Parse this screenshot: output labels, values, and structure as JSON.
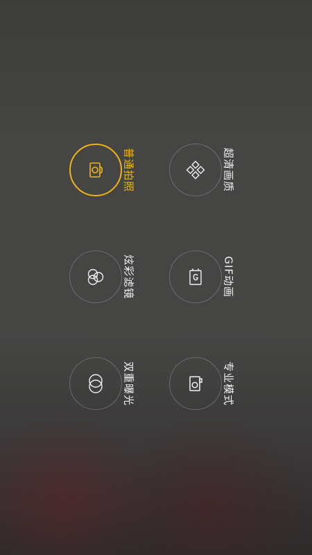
{
  "modes": [
    {
      "key": "normal",
      "label": "普通拍照",
      "icon": "camera-icon",
      "active": true
    },
    {
      "key": "uhd",
      "label": "超清画质",
      "icon": "diamond-grid-icon",
      "active": false
    },
    {
      "key": "filter",
      "label": "炫彩滤镜",
      "icon": "color-filter-icon",
      "active": false
    },
    {
      "key": "gif",
      "label": "GIF动画",
      "icon": "gif-icon",
      "active": false
    },
    {
      "key": "double",
      "label": "双重曝光",
      "icon": "double-exposure-icon",
      "active": false
    },
    {
      "key": "pro",
      "label": "专业模式",
      "icon": "pro-camera-icon",
      "active": false
    }
  ],
  "colors": {
    "accent": "#f0b416",
    "ring": "rgba(255,255,255,0.22)",
    "text": "#f2f2f2"
  }
}
